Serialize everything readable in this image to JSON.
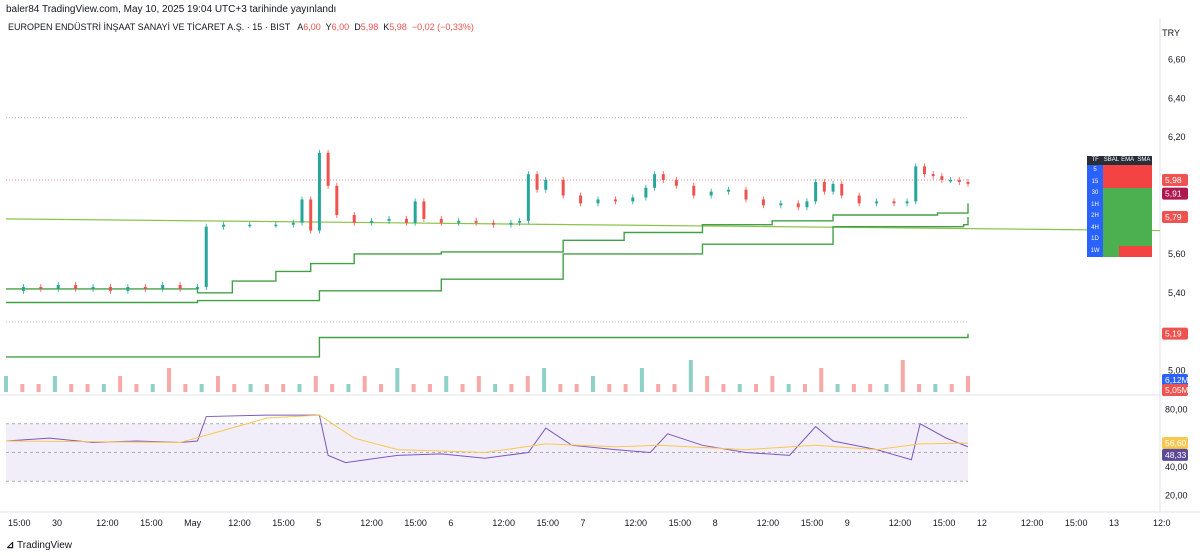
{
  "publisher_line": "baler84 TradingView.com, May 10, 2025 19:04 UTC+3 tarihinde yayınlandı",
  "legend": {
    "symbol": "EUROPEN ENDÜSTRİ İNŞAAT SANAYİ VE TİCARET A.Ş. · 15 · BIST",
    "open_label": "A",
    "open": "6,00",
    "high_label": "Y",
    "high": "6,00",
    "low_label": "D",
    "low": "5,98",
    "close_label": "K",
    "close": "5,98",
    "change": "−0,02 (−0,33%)"
  },
  "currency": "TRY",
  "footer": "TradingView",
  "colors": {
    "up": "#26a69a",
    "down": "#ef5350",
    "bull_line": "#43a047",
    "bear_line": "#b0174f",
    "rsi": "#7e57c2",
    "rsi_ma": "#f9c74f"
  },
  "tf_table": {
    "headers": [
      "TF",
      "SBAL",
      "EMA",
      "SMA"
    ],
    "rows": [
      {
        "tf": "5",
        "cells": [
          "red",
          "red",
          "red"
        ]
      },
      {
        "tf": "15",
        "cells": [
          "red",
          "red",
          "red"
        ]
      },
      {
        "tf": "30",
        "cells": [
          "green",
          "green",
          "green"
        ]
      },
      {
        "tf": "1H",
        "cells": [
          "green",
          "green",
          "green"
        ]
      },
      {
        "tf": "2H",
        "cells": [
          "green",
          "green",
          "green"
        ]
      },
      {
        "tf": "4H",
        "cells": [
          "green",
          "green",
          "green"
        ]
      },
      {
        "tf": "1D",
        "cells": [
          "green",
          "green",
          "green"
        ]
      },
      {
        "tf": "1W",
        "cells": [
          "green",
          "red",
          "red"
        ]
      }
    ]
  },
  "chart_data": {
    "type": "candlestick",
    "price_axis": {
      "ticks": [
        "6,60",
        "6,40",
        "6,20",
        "5,60",
        "5,40",
        "5,00"
      ],
      "range": [
        4.9,
        6.7
      ]
    },
    "rsi_axis": {
      "ticks": [
        "80,00",
        "40,00",
        "20,00"
      ],
      "range": [
        10,
        90
      ],
      "bands": [
        70,
        50,
        30
      ]
    },
    "price_labels": [
      {
        "text": "5,98",
        "value": 5.98,
        "color": "#ef5350"
      },
      {
        "text": "5,91",
        "value": 5.91,
        "color": "#b0174f"
      },
      {
        "text": "5,79",
        "value": 5.79,
        "color": "#ef5350"
      },
      {
        "text": "5,19",
        "value": 5.19,
        "color": "#ef5350"
      }
    ],
    "volume_labels": [
      {
        "text": "6,12M",
        "color": "#2962ff"
      },
      {
        "text": "5,05M",
        "color": "#ef5350"
      }
    ],
    "rsi_labels": [
      {
        "text": "56,60",
        "value": 56.6,
        "color": "#f9c74f"
      },
      {
        "text": "48,33",
        "value": 48.33,
        "color": "#5c4a99"
      }
    ],
    "time_axis": [
      "15:00",
      "30",
      "12:00",
      "15:00",
      "May",
      "12:00",
      "15:00",
      "5",
      "12:00",
      "15:00",
      "6",
      "12:00",
      "15:00",
      "7",
      "12:00",
      "15:00",
      "8",
      "12:00",
      "15:00",
      "9",
      "12:00",
      "15:00",
      "12",
      "12:00",
      "15:00",
      "13",
      "12:0"
    ],
    "price_path": [
      [
        0,
        5.41
      ],
      [
        4,
        5.43
      ],
      [
        8,
        5.42
      ],
      [
        12,
        5.44
      ],
      [
        16,
        5.42
      ],
      [
        20,
        5.43
      ],
      [
        24,
        5.41
      ],
      [
        28,
        5.43
      ],
      [
        32,
        5.42
      ],
      [
        36,
        5.44
      ],
      [
        40,
        5.42
      ],
      [
        44,
        5.43
      ],
      [
        46,
        5.74
      ],
      [
        50,
        5.75
      ],
      [
        56,
        5.75
      ],
      [
        62,
        5.75
      ],
      [
        66,
        5.76
      ],
      [
        68,
        5.88
      ],
      [
        70,
        5.72
      ],
      [
        72,
        6.12
      ],
      [
        74,
        5.95
      ],
      [
        76,
        5.8
      ],
      [
        80,
        5.76
      ],
      [
        84,
        5.77
      ],
      [
        88,
        5.78
      ],
      [
        92,
        5.76
      ],
      [
        94,
        5.87
      ],
      [
        96,
        5.78
      ],
      [
        100,
        5.76
      ],
      [
        104,
        5.77
      ],
      [
        108,
        5.76
      ],
      [
        112,
        5.75
      ],
      [
        116,
        5.76
      ],
      [
        118,
        5.77
      ],
      [
        120,
        6.01
      ],
      [
        122,
        5.93
      ],
      [
        124,
        5.98
      ],
      [
        128,
        5.9
      ],
      [
        132,
        5.86
      ],
      [
        136,
        5.88
      ],
      [
        140,
        5.87
      ],
      [
        144,
        5.89
      ],
      [
        147,
        5.94
      ],
      [
        149,
        6.01
      ],
      [
        151,
        5.98
      ],
      [
        154,
        5.95
      ],
      [
        158,
        5.9
      ],
      [
        162,
        5.92
      ],
      [
        166,
        5.93
      ],
      [
        170,
        5.88
      ],
      [
        174,
        5.85
      ],
      [
        178,
        5.86
      ],
      [
        182,
        5.84
      ],
      [
        184,
        5.87
      ],
      [
        186,
        5.97
      ],
      [
        188,
        5.92
      ],
      [
        190,
        5.96
      ],
      [
        192,
        5.9
      ],
      [
        196,
        5.86
      ],
      [
        200,
        5.87
      ],
      [
        204,
        5.86
      ],
      [
        207,
        5.87
      ],
      [
        209,
        6.05
      ],
      [
        211,
        6.01
      ],
      [
        213,
        6.0
      ],
      [
        215,
        5.98
      ],
      [
        217,
        5.98
      ],
      [
        219,
        5.97
      ],
      [
        221,
        5.96
      ]
    ],
    "volume": [
      2,
      1,
      1,
      2,
      1,
      1,
      1,
      2,
      1,
      1,
      3,
      1,
      1,
      2,
      1,
      1,
      1,
      1,
      1,
      2,
      1,
      1,
      2,
      1,
      3,
      1,
      1,
      2,
      1,
      2,
      1,
      1,
      2,
      3,
      1,
      1,
      2,
      1,
      1,
      3,
      1,
      1,
      4,
      2,
      1,
      1,
      1,
      2,
      1,
      1,
      3,
      1,
      1,
      1,
      1,
      4,
      1,
      1,
      1,
      2
    ],
    "rsi_path": [
      [
        0,
        58
      ],
      [
        10,
        60
      ],
      [
        20,
        57
      ],
      [
        30,
        58
      ],
      [
        40,
        57
      ],
      [
        44,
        58
      ],
      [
        46,
        75
      ],
      [
        60,
        76
      ],
      [
        72,
        76
      ],
      [
        74,
        48
      ],
      [
        78,
        43
      ],
      [
        90,
        48
      ],
      [
        100,
        49
      ],
      [
        110,
        46
      ],
      [
        120,
        50
      ],
      [
        124,
        67
      ],
      [
        130,
        55
      ],
      [
        140,
        52
      ],
      [
        148,
        50
      ],
      [
        152,
        63
      ],
      [
        160,
        55
      ],
      [
        170,
        50
      ],
      [
        180,
        48
      ],
      [
        186,
        68
      ],
      [
        190,
        58
      ],
      [
        200,
        52
      ],
      [
        208,
        45
      ],
      [
        210,
        70
      ],
      [
        216,
        60
      ],
      [
        221,
        54
      ]
    ],
    "rsi_ma_path": [
      [
        0,
        58
      ],
      [
        40,
        57
      ],
      [
        46,
        62
      ],
      [
        60,
        74
      ],
      [
        72,
        76
      ],
      [
        80,
        60
      ],
      [
        90,
        52
      ],
      [
        110,
        50
      ],
      [
        124,
        56
      ],
      [
        140,
        54
      ],
      [
        150,
        55
      ],
      [
        170,
        52
      ],
      [
        186,
        55
      ],
      [
        200,
        52
      ],
      [
        210,
        56
      ],
      [
        221,
        56.6
      ]
    ]
  }
}
